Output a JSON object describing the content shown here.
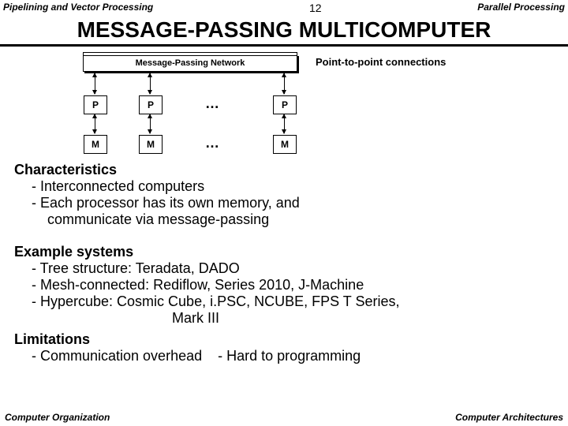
{
  "header": {
    "left": "Pipelining and Vector Processing",
    "center": "12",
    "right": "Parallel Processing"
  },
  "title": "MESSAGE-PASSING  MULTICOMPUTER",
  "diagram": {
    "network_label": "Message-Passing Network",
    "ptp_label": "Point-to-point connections",
    "p": "P",
    "m": "M",
    "dots": "…"
  },
  "characteristics": {
    "heading": "Characteristics",
    "items": [
      "- Interconnected computers",
      "- Each processor has its own memory, and",
      "communicate via message-passing"
    ]
  },
  "examples": {
    "heading": "Example systems",
    "items": [
      "- Tree structure: Teradata, DADO",
      "- Mesh-connected: Rediflow, Series 2010, J-Machine",
      "- Hypercube: Cosmic Cube, i.PSC, NCUBE, FPS T Series,",
      "Mark III"
    ]
  },
  "limitations": {
    "heading": "Limitations",
    "item1": "- Communication overhead",
    "item2": "- Hard to programming"
  },
  "footer": {
    "left": "Computer Organization",
    "right": "Computer Architectures"
  }
}
